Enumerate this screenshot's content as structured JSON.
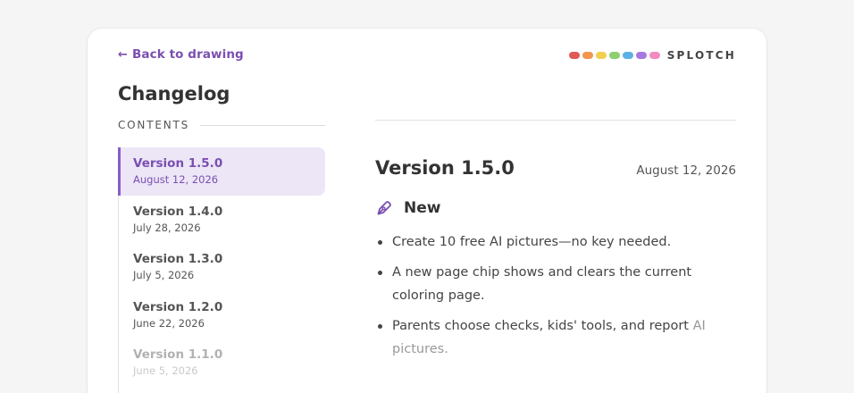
{
  "nav": {
    "back_arrow": "←",
    "back_label": "Back to drawing"
  },
  "brand": {
    "name": "SPLOTCH",
    "dot_colors": [
      "#e05a57",
      "#f0964f",
      "#f2cf4f",
      "#8fcf6f",
      "#5db0e6",
      "#a878e0",
      "#f28cc0"
    ]
  },
  "sidebar": {
    "title": "Changelog",
    "contents_label": "CONTENTS",
    "items": [
      {
        "version": "Version 1.5.0",
        "date": "August 12, 2026",
        "active": true
      },
      {
        "version": "Version 1.4.0",
        "date": "July 28, 2026",
        "active": false
      },
      {
        "version": "Version 1.3.0",
        "date": "July 5, 2026",
        "active": false
      },
      {
        "version": "Version 1.2.0",
        "date": "June 22, 2026",
        "active": false
      },
      {
        "version": "Version 1.1.0",
        "date": "June 5, 2026",
        "active": false
      }
    ]
  },
  "main": {
    "version_title": "Version 1.5.0",
    "version_date": "August 12, 2026",
    "section": {
      "icon": "pen-icon",
      "label": "New"
    },
    "bullets": [
      {
        "text": "Create 10 free AI pictures—no key needed."
      },
      {
        "text": "A new page chip shows and clears the current coloring page."
      },
      {
        "text": "Parents choose checks, kids' tools, and report",
        "muted_tail": "AI pictures."
      }
    ]
  },
  "colors": {
    "accent": "#7b4fb0",
    "active_bg": "#ece6f7",
    "page_bg": "#f5f5f5"
  }
}
